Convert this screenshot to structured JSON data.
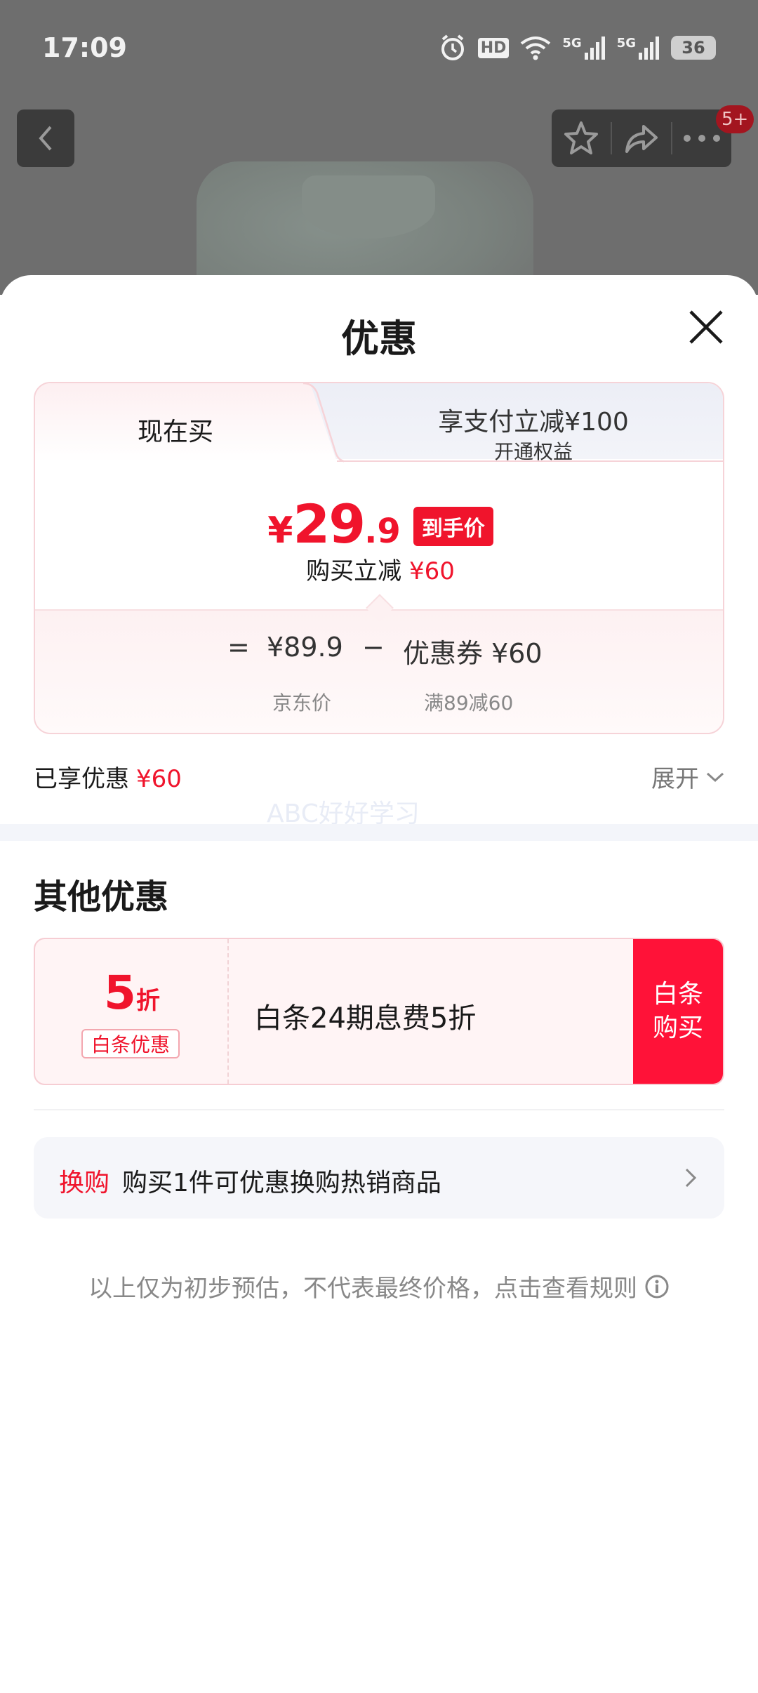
{
  "status_bar": {
    "time": "17:09",
    "icons": [
      "alarm-icon",
      "hd-icon",
      "wifi-icon",
      "signal-5g-icon",
      "signal-5g-icon",
      "battery-icon"
    ],
    "hd_label": "HD",
    "net1_label": "5G",
    "net2_label": "5G",
    "battery_level": "36"
  },
  "top_nav": {
    "back_icon": "chevron-left-icon",
    "action_icons": [
      "star-icon",
      "share-icon",
      "more-icon"
    ],
    "badge": "5+"
  },
  "sheet": {
    "title": "优惠",
    "close_icon": "close-icon",
    "tabs": [
      {
        "label": "现在买"
      },
      {
        "label": "享支付立减¥100",
        "sublabel": "开通权益"
      }
    ],
    "price": {
      "symbol": "¥",
      "integer": "29",
      "decimal": ".9",
      "tag": "到手价"
    },
    "discount": {
      "label": "购买立减",
      "amount": "¥60"
    },
    "breakdown": {
      "equals": "=",
      "base_price": "¥89.9",
      "minus": "−",
      "coupon": "优惠券 ¥60",
      "base_label": "京东价",
      "coupon_label": "满89减60"
    },
    "enjoyed": {
      "label": "已享优惠",
      "amount": "¥60"
    },
    "expand_label": "展开",
    "watermark": "ABC好好学习",
    "other_section": {
      "title": "其他优惠",
      "coupon": {
        "rate_number": "5",
        "rate_unit": "折",
        "chip": "白条优惠",
        "description": "白条24期息费5折",
        "button_line1": "白条",
        "button_line2": "购买"
      },
      "swap": {
        "tag": "换购",
        "text": "购买1件可优惠换购热销商品"
      }
    },
    "footnote": "以上仅为初步预估，不代表最终价格，点击查看规则"
  },
  "colors": {
    "accent_red": "#f0142c",
    "button_red": "#ff1238",
    "overlay_gray": "#6e6e6e"
  }
}
